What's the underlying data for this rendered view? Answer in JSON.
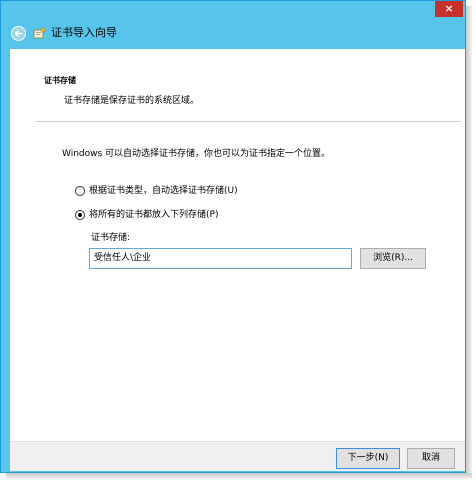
{
  "window": {
    "title": "证书导入向导",
    "close_glyph": "×",
    "accent_color": "#57c4ec",
    "close_color": "#c7312a"
  },
  "page": {
    "section_title": "证书存储",
    "section_desc": "证书存储是保存证书的系统区域。",
    "intro": "Windows 可以自动选择证书存储，你也可以为证书指定一个位置。"
  },
  "options": [
    {
      "label": "根据证书类型，自动选择证书存储(U)",
      "selected": false
    },
    {
      "label": "将所有的证书都放入下列存储(P)",
      "selected": true
    }
  ],
  "store": {
    "label": "证书存储:",
    "value": "受信任人\\企业",
    "browse_label": "浏览(R)..."
  },
  "footer": {
    "next_label": "下一步(N)",
    "cancel_label": "取消"
  }
}
